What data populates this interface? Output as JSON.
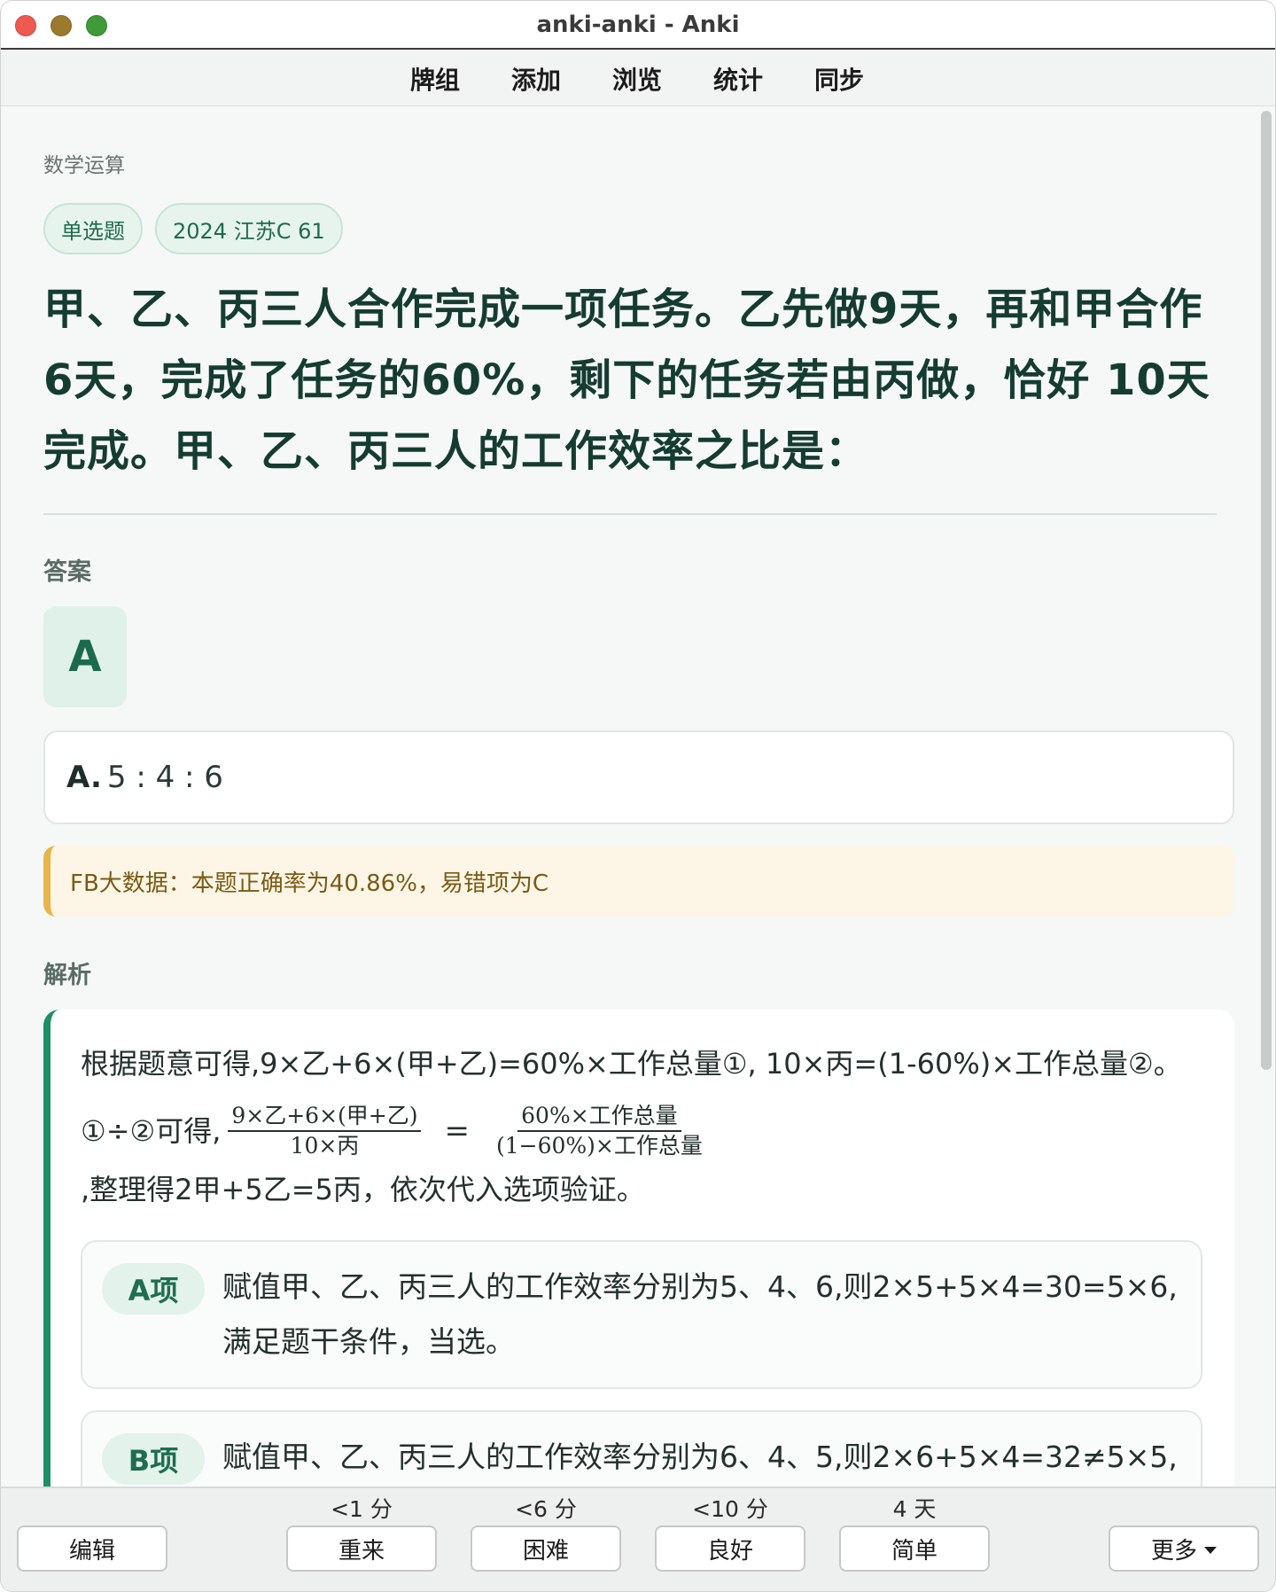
{
  "window": {
    "title": "anki-anki - Anki"
  },
  "menu": {
    "items": [
      "牌组",
      "添加",
      "浏览",
      "统计",
      "同步"
    ]
  },
  "card": {
    "category": "数学运算",
    "tags": [
      "单选题",
      "2024 江苏C 61"
    ],
    "question": "甲、乙、丙三人合作完成一项任务。乙先做9天，再和甲合作6天，完成了任务的60%，剩下的任务若由丙做，恰好 10天完成。甲、乙、丙三人的工作效率之比是：",
    "answer_label": "答案",
    "answer": "A",
    "option_letter": "A.",
    "option_text": "5 : 4 : 6",
    "fb_stat": "FB大数据：本题正确率为40.86%，易错项为C",
    "analysis_label": "解析",
    "analysis_p1": "根据题意可得,9×乙+6×(甲+乙)=60%×工作总量①, 10×丙=(1-60%)×工作总量②。",
    "analysis_p2_prefix": "①÷②可得,",
    "frac1_num": "9×乙+6×(甲+乙)",
    "frac1_den": "10×丙",
    "eq_sign": "=",
    "frac2_num": "60%×工作总量",
    "frac2_den": "(1−60%)×工作总量",
    "analysis_p2_suffix": ",整理得2甲+5乙=5丙，依次代入选项验证。",
    "sub_items": [
      {
        "badge": "A项",
        "text": "赋值甲、乙、丙三人的工作效率分别为5、4、6,则2×5+5×4=30=5×6,满足题干条件，当选。"
      },
      {
        "badge": "B项",
        "text": "赋值甲、乙、丙三人的工作效率分别为6、4、5,则2×6+5×4=32≠5×5,"
      }
    ]
  },
  "bottom": {
    "edit": "编辑",
    "more": "更多",
    "buttons": [
      {
        "label": "重来",
        "due": "<1 分"
      },
      {
        "label": "困难",
        "due": "<6 分"
      },
      {
        "label": "良好",
        "due": "<10 分"
      },
      {
        "label": "简单",
        "due": "4 天"
      }
    ]
  }
}
